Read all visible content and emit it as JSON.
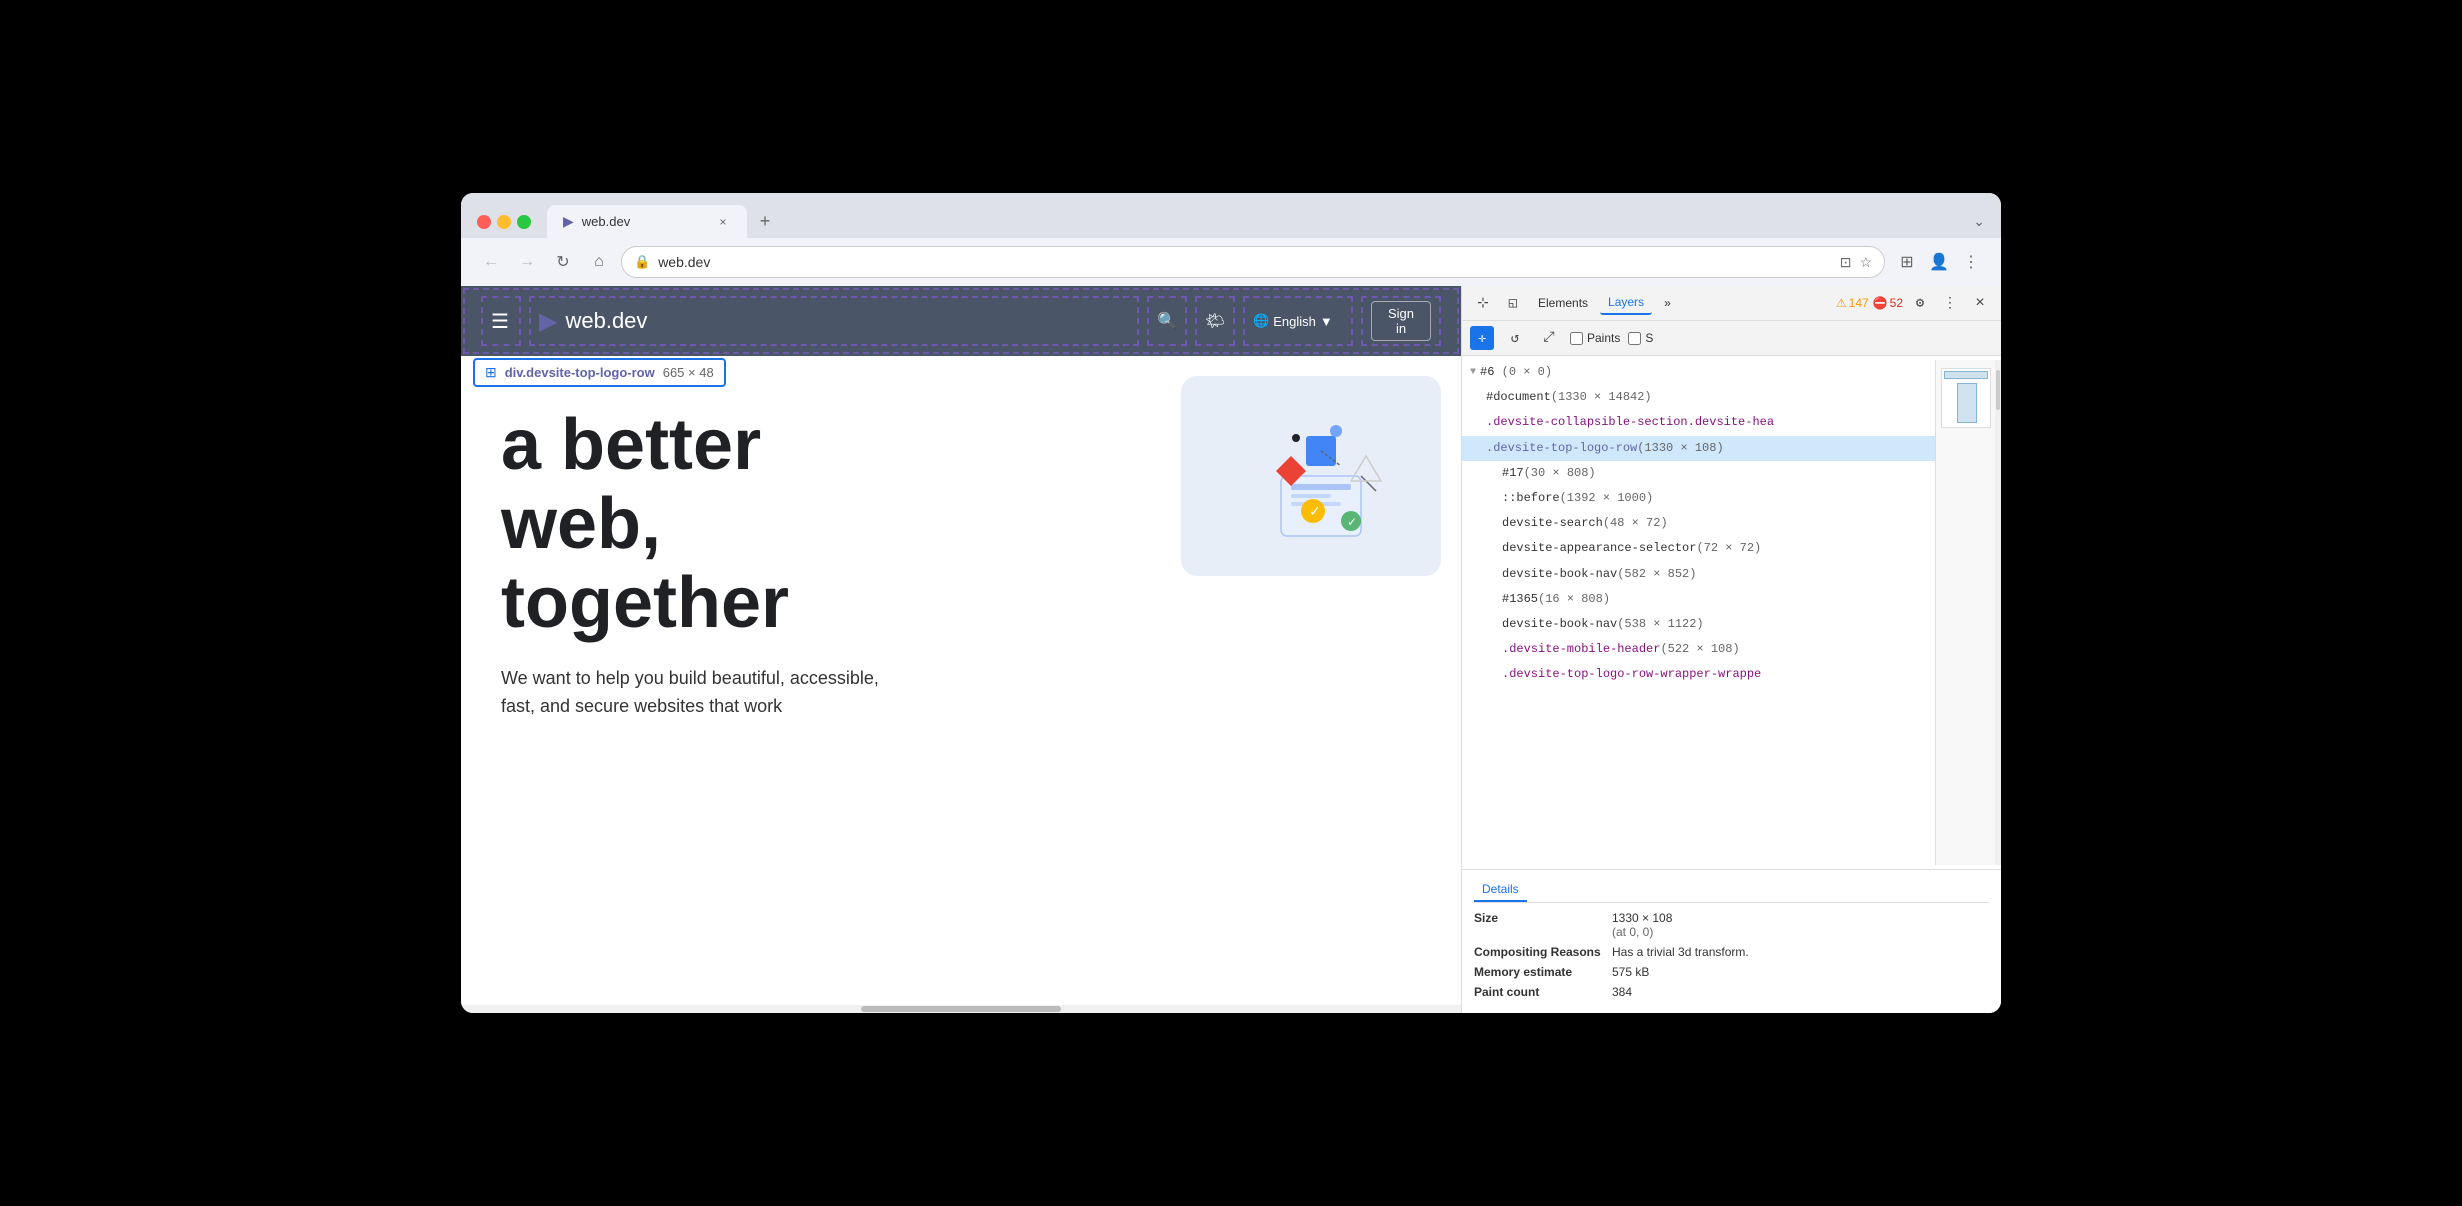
{
  "browser": {
    "tab_title": "web.dev",
    "tab_favicon": "▶",
    "tab_close": "×",
    "new_tab": "+",
    "expand_btn": "⌄",
    "address": "web.dev",
    "back_disabled": true,
    "forward_disabled": true
  },
  "nav": {
    "back_label": "←",
    "forward_label": "→",
    "reload_label": "↻",
    "home_label": "⌂",
    "address_icon": "🔒",
    "address_url": "web.dev",
    "cast_icon": "⊡",
    "bookmark_icon": "☆",
    "extensions_icon": "⊞",
    "profile_icon": "👤",
    "menu_icon": "⋮"
  },
  "webpage": {
    "header_menu": "☰",
    "header_logo_icon": "▶",
    "header_logo_text": "web.dev",
    "header_search": "🔍",
    "header_theme": "🌤",
    "header_lang": "English",
    "header_lang_arrow": "▼",
    "header_signin": "Sign in",
    "element_label": "div.devsite-top-logo-row",
    "element_size": "665 × 48",
    "headline_line1": "a better",
    "headline_line2": "web,",
    "headline_line3": "together",
    "subtext": "We want to help you build beautiful, accessible, fast, and secure websites that work"
  },
  "devtools": {
    "cursor_icon": "⊹",
    "device_icon": "◱",
    "elements_tab": "Elements",
    "layers_tab": "Layers",
    "more_tabs": "»",
    "warning_icon": "⚠",
    "warning_count": "147",
    "error_icon": "⛔",
    "error_count": "52",
    "settings_icon": "⚙",
    "menu_icon": "⋮",
    "close_icon": "×",
    "move_icon": "✛",
    "rotate_icon": "↺",
    "scale_icon": "⤢",
    "paints_checkbox": "Paints",
    "s_checkbox": "S",
    "tree_items": [
      {
        "indent": 0,
        "arrow": "▼",
        "name": "#6",
        "extra": "(0 × 0)"
      },
      {
        "indent": 1,
        "arrow": "",
        "name": "#document",
        "extra": "(1330 × 14842)"
      },
      {
        "indent": 1,
        "arrow": "",
        "name": ".devsite-collapsible-section.devsite-hea",
        "extra": ""
      },
      {
        "indent": 1,
        "arrow": "",
        "name": ".devsite-top-logo-row",
        "extra": "(1330 × 108)",
        "selected": true
      },
      {
        "indent": 2,
        "arrow": "",
        "name": "#17",
        "extra": "(30 × 808)"
      },
      {
        "indent": 2,
        "arrow": "",
        "name": "::before",
        "extra": "(1392 × 1000)"
      },
      {
        "indent": 2,
        "arrow": "",
        "name": "devsite-search",
        "extra": "(48 × 72)"
      },
      {
        "indent": 2,
        "arrow": "",
        "name": "devsite-appearance-selector",
        "extra": "(72 × 72)"
      },
      {
        "indent": 2,
        "arrow": "",
        "name": "devsite-book-nav",
        "extra": "(582 × 852)"
      },
      {
        "indent": 2,
        "arrow": "",
        "name": "#1365",
        "extra": "(16 × 808)"
      },
      {
        "indent": 2,
        "arrow": "",
        "name": "devsite-book-nav",
        "extra": "(538 × 1122)"
      },
      {
        "indent": 2,
        "arrow": "",
        "name": ".devsite-mobile-header",
        "extra": "(522 × 108)"
      },
      {
        "indent": 2,
        "arrow": "",
        "name": ".devsite-top-logo-row-wrapper-wrappe",
        "extra": ""
      }
    ],
    "details_tab": "Details",
    "details": {
      "size_label": "Size",
      "size_value": "1330 × 108",
      "size_sub": "(at 0, 0)",
      "compositing_label": "Compositing Reasons",
      "compositing_value": "Has a trivial 3d transform.",
      "memory_label": "Memory estimate",
      "memory_value": "575 kB",
      "paint_count_label": "Paint count",
      "paint_count_value": "384"
    }
  }
}
